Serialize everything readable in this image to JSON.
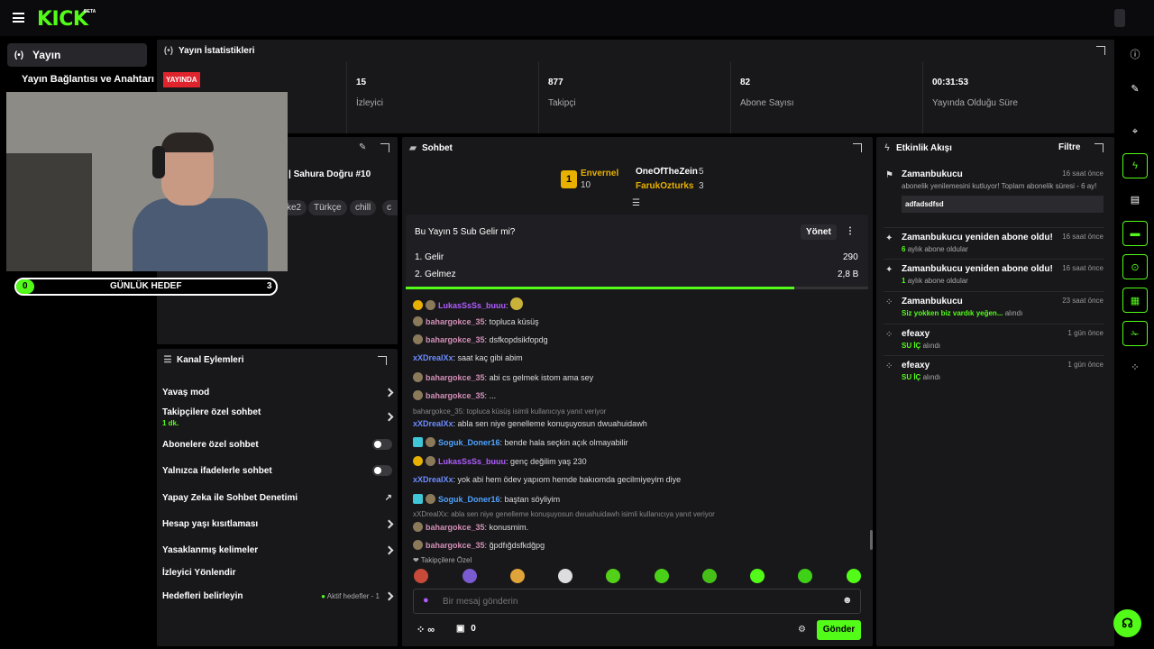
{
  "app": {
    "logo": "KICK",
    "logo_badge": "BETA"
  },
  "sidebar": {
    "items": [
      {
        "label": "Yayın",
        "icon": "broadcast-icon"
      },
      {
        "label": "Yayın Bağlantısı ve Anahtarı"
      }
    ]
  },
  "goal": {
    "label": "GÜNLÜK HEDEF",
    "current": "0",
    "target": "3",
    "progress": 0
  },
  "stats": {
    "title": "Yayın İstatistikleri",
    "live_badge": "YAYINDA",
    "items": [
      {
        "value": "15",
        "label": "İzleyici"
      },
      {
        "value": "877",
        "label": "Takipçi"
      },
      {
        "value": "82",
        "label": "Abone Sayısı"
      },
      {
        "value": "00:31:53",
        "label": "Yayında Olduğu Süre"
      }
    ]
  },
  "stream_info": {
    "title_fragment": "| Sahura Doğru #10",
    "tags": [
      "ke2",
      "Türkçe",
      "chill",
      "c"
    ]
  },
  "channel_actions": {
    "title": "Kanal Eylemleri",
    "items": [
      {
        "label": "Yavaş mod",
        "control": "chevron"
      },
      {
        "label": "Takipçilere özel sohbet",
        "sub": "1 dk.",
        "control": "chevron"
      },
      {
        "label": "Abonelere özel sohbet",
        "control": "toggle"
      },
      {
        "label": "Yalnızca ifadelerle sohbet",
        "control": "toggle"
      },
      {
        "label": "Yapay Zeka ile Sohbet Denetimi",
        "control": "external"
      },
      {
        "label": "Hesap yaşı kısıtlaması",
        "control": "chevron"
      },
      {
        "label": "Yasaklanmış kelimeler",
        "control": "chevron"
      },
      {
        "label": "İzleyici Yönlendir",
        "control": "none"
      },
      {
        "label": "Hedefleri belirleyin",
        "control": "chevron",
        "extra": "Aktif hedefler - 1"
      }
    ]
  },
  "chat": {
    "title": "Sohbet",
    "top_gifters": [
      {
        "rank": "1",
        "name": "Envernel",
        "count": "10"
      },
      {
        "name": "OneOfTheZein",
        "count": "5"
      },
      {
        "name": "FarukOzturks",
        "count": "3"
      }
    ],
    "poll": {
      "question": "Bu Yayın 5 Sub Gelir mi?",
      "manage_label": "Yönet",
      "options": [
        {
          "label": "1. Gelir",
          "votes": "290"
        },
        {
          "label": "2. Gelmez",
          "votes": "2,8 B"
        }
      ],
      "progress": 0.84
    },
    "messages": [
      {
        "user": "LukasSsSs_buuu",
        "text": "",
        "color": "#b05cff",
        "badges": [
          "gift",
          "sub"
        ],
        "emote": true
      },
      {
        "user": "bahargokce_35",
        "text": "topluca küsüş",
        "color": "#d28fb6",
        "badges": [
          "sub"
        ]
      },
      {
        "user": "bahargokce_35",
        "text": "dsfkopdsikfopdg",
        "color": "#d28fb6",
        "badges": [
          "sub"
        ]
      },
      {
        "user": "xXDrealXx",
        "text": "saat kaç gibi abim",
        "color": "#6c8cff",
        "badges": []
      },
      {
        "user": "bahargokce_35",
        "text": "abi cs gelmek istom ama sey",
        "color": "#d28fb6",
        "badges": [
          "sub"
        ]
      },
      {
        "user": "bahargokce_35",
        "text": "...",
        "color": "#d28fb6",
        "badges": [
          "sub"
        ]
      },
      {
        "reply": "bahargokce_35: topluca küsüş isimli kullanıcıya yanıt veriyor",
        "user": "xXDrealXx",
        "text": "abla sen niye genelleme konuşuyosun dwuahuidawh",
        "color": "#6c8cff",
        "badges": []
      },
      {
        "user": "Soguk_Doner16",
        "text": "bende hala seçkin açık olmayabilir",
        "color": "#4fa3ff",
        "badges": [
          "mod",
          "sub"
        ]
      },
      {
        "user": "LukasSsSs_buuu",
        "text": "genç değilim yaş 230",
        "color": "#b05cff",
        "badges": [
          "gift",
          "sub"
        ]
      },
      {
        "user": "xXDrealXx",
        "text": "yok abi hem ödev yapıom hemde bakıomda gecilmiyeyim diye",
        "color": "#6c8cff",
        "badges": []
      },
      {
        "user": "Soguk_Doner16",
        "text": "baştan söyliyim",
        "color": "#4fa3ff",
        "badges": [
          "mod",
          "sub"
        ]
      },
      {
        "reply": "xXDrealXx: abla sen niye genelleme konuşuyosun dwuahuidawh isimli kullanıcıya yanıt veriyor",
        "user": "bahargokce_35",
        "text": "konusmim.",
        "color": "#d28fb6",
        "badges": [
          "sub"
        ]
      },
      {
        "user": "bahargokce_35",
        "text": "ğpdfığdsfkdğpg",
        "color": "#d28fb6",
        "badges": [
          "sub"
        ]
      }
    ],
    "followers_only_label": "Takipçilere Özel",
    "input_placeholder": "Bir mesaj gönderin",
    "points": "∞",
    "store_count": "0",
    "send_label": "Gönder"
  },
  "activity": {
    "title": "Etkinlik Akışı",
    "filter_label": "Filtre",
    "items": [
      {
        "icon": "host-icon",
        "title": "Zamanbukucu",
        "time": "16 saat önce",
        "sub": "abonelik yenilemesini kutluyor! Toplam abonelik süresi - 6 ay!",
        "message": "adfadsdfsd"
      },
      {
        "icon": "sparkle-icon",
        "title": "Zamanbukucu yeniden abone oldu!",
        "time": "16 saat önce",
        "sub_num": "6",
        "sub": "aylık abone oldular"
      },
      {
        "icon": "sparkle-icon",
        "title": "Zamanbukucu yeniden abone oldu!",
        "time": "16 saat önce",
        "sub_num": "1",
        "sub": "aylık abone oldular"
      },
      {
        "icon": "redeem-icon",
        "title": "Zamanbukucu",
        "time": "23 saat önce",
        "sub_hl": "Siz yokken biz vardık yeğen...",
        "sub": "alındı"
      },
      {
        "icon": "redeem-icon",
        "title": "efeaxy",
        "time": "1 gün önce",
        "sub_hl": "SU İÇ",
        "sub": "alındı"
      },
      {
        "icon": "redeem-icon",
        "title": "efeaxy",
        "time": "1 gün önce",
        "sub_hl": "SU İÇ",
        "sub": "alındı"
      }
    ]
  },
  "colors": {
    "accent": "#53fc18",
    "panel": "#18181b",
    "live": "#e0242e"
  }
}
